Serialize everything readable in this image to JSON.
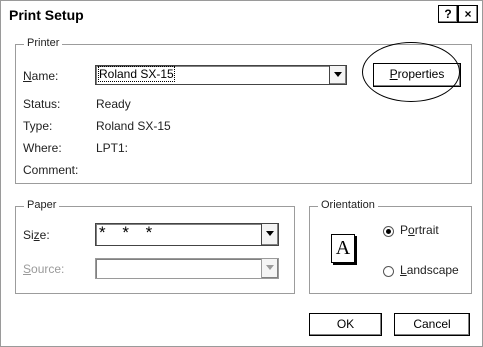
{
  "window": {
    "title": "Print Setup",
    "help_button": "?",
    "close_button": "×"
  },
  "printer": {
    "group_label": "Printer",
    "name_label_prefix": "",
    "name_label_mnemonic": "N",
    "name_label_rest": "ame:",
    "name_value": "Roland SX-15",
    "properties_mnemonic": "P",
    "properties_rest": "roperties",
    "status_label": "Status:",
    "status_value": "Ready",
    "type_label": "Type:",
    "type_value": "Roland SX-15",
    "where_label": "Where:",
    "where_value": "LPT1:",
    "comment_label": "Comment:",
    "comment_value": ""
  },
  "paper": {
    "group_label": "Paper",
    "size_label_prefix": "Si",
    "size_label_mnemonic": "z",
    "size_label_rest": "e:",
    "size_value": "* * *",
    "source_label_mnemonic": "S",
    "source_label_rest": "ource:",
    "source_value": ""
  },
  "orientation": {
    "group_label": "Orientation",
    "icon_letter": "A",
    "portrait_prefix": "P",
    "portrait_mnemonic": "o",
    "portrait_rest": "rtrait",
    "landscape_mnemonic": "L",
    "landscape_rest": "andscape",
    "selected": "portrait"
  },
  "buttons": {
    "ok_label": "OK",
    "cancel_label": "Cancel"
  }
}
